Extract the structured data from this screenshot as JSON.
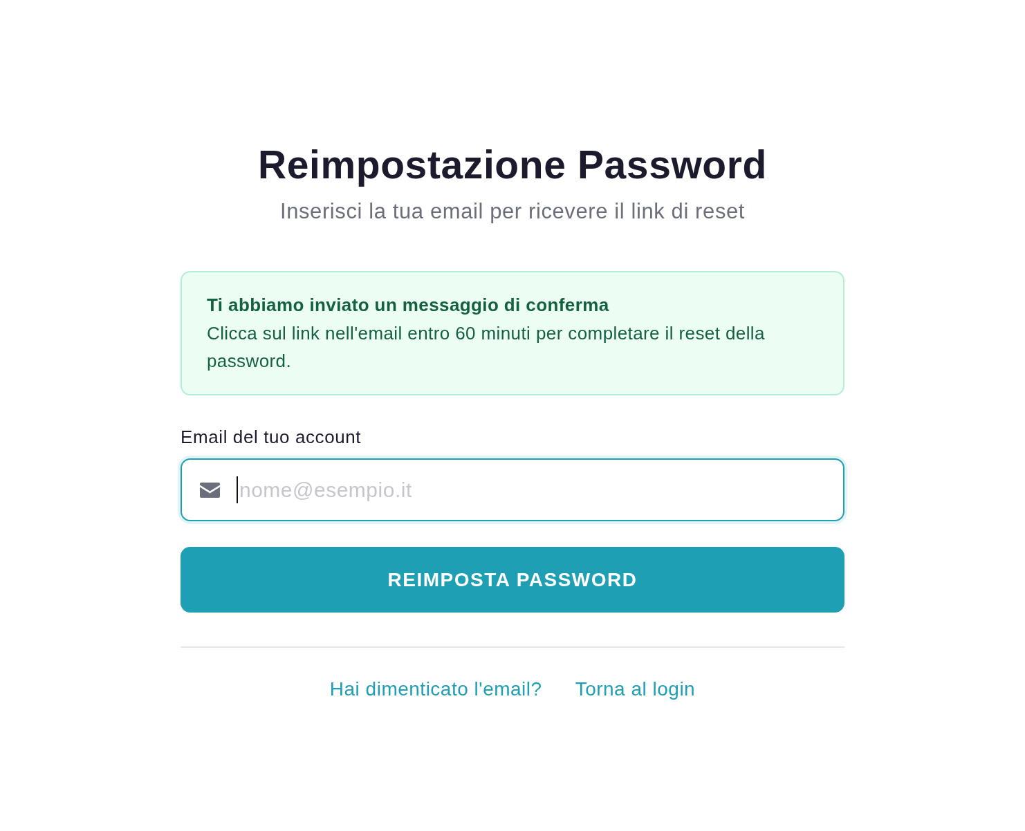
{
  "page": {
    "title": "Reimpostazione Password",
    "subtitle": "Inserisci la tua email per ricevere il link di reset"
  },
  "alert": {
    "kind": "success",
    "title": "Ti abbiamo inviato un messaggio di conferma",
    "message": "Clicca sul link nell'email entro 60 minuti per completare il reset della password."
  },
  "form": {
    "email_field": {
      "label": "Email del tuo account",
      "placeholder": "nome@esempio.it",
      "focused": true
    },
    "submit_button": "REIMPOSTA PASSWORD"
  },
  "links": [
    {
      "label": "Hai dimenticato l'email?"
    },
    {
      "label": "Torna al login"
    }
  ]
}
